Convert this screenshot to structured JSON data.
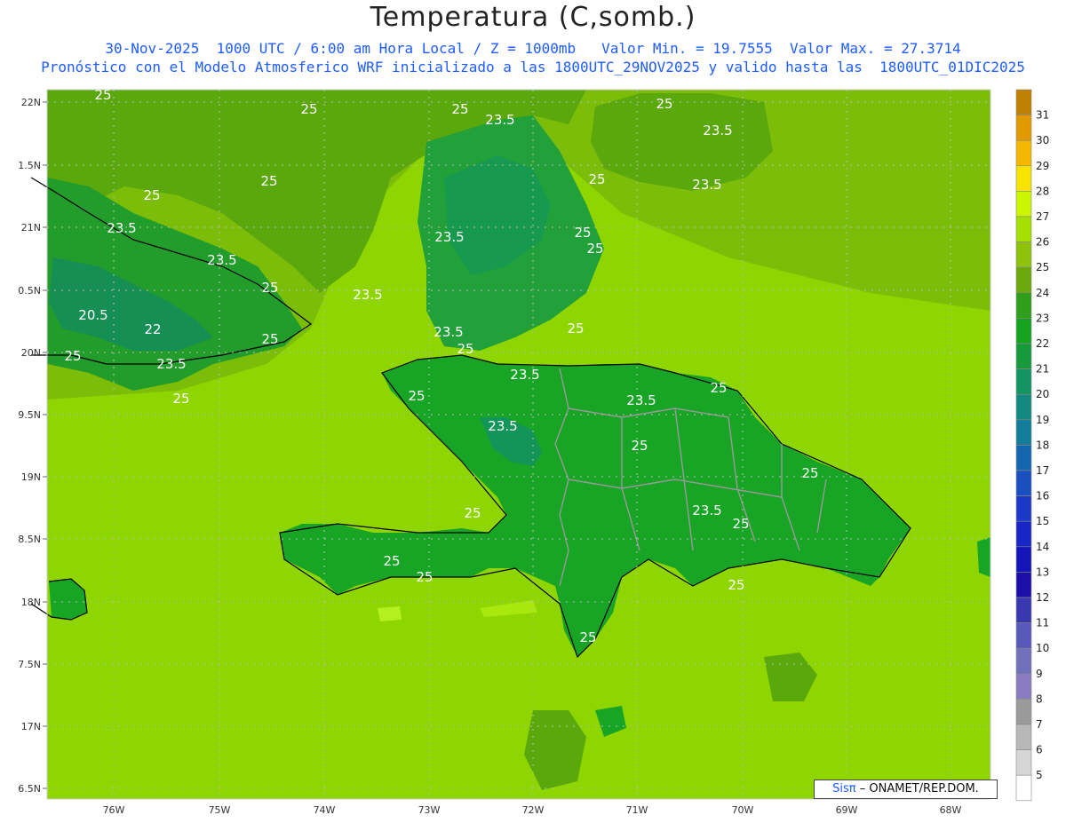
{
  "header": {
    "title": "Temperatura (C,somb.)",
    "line1": "30-Nov-2025  1000 UTC / 6:00 am Hora Local / Z = 1000mb   Valor Min. = 19.7555  Valor Max. = 27.3714",
    "line2": "Pronóstico con el Modelo Atmosferico WRF inicializado a las 1800UTC_29NOV2025 y valido hasta las  1800UTC_01DIC2025"
  },
  "map": {
    "lat_labels": [
      "22N",
      "1.5N",
      "21N",
      "0.5N",
      "20N",
      "9.5N",
      "19N",
      "8.5N",
      "18N",
      "7.5N",
      "17N",
      "6.5N"
    ],
    "lon_labels": [
      "76W",
      "75W",
      "74W",
      "73W",
      "72W",
      "71W",
      "70W",
      "69W",
      "68W"
    ],
    "contour_labels": [
      {
        "text": "25"
      },
      {
        "text": "25"
      },
      {
        "text": "25"
      },
      {
        "text": "23.5"
      },
      {
        "text": "25"
      },
      {
        "text": "23.5"
      },
      {
        "text": "25"
      },
      {
        "text": "25"
      },
      {
        "text": "23.5"
      },
      {
        "text": "25"
      },
      {
        "text": "23.5"
      },
      {
        "text": "25"
      },
      {
        "text": "25"
      },
      {
        "text": "20.5"
      },
      {
        "text": "22"
      },
      {
        "text": "23.5"
      },
      {
        "text": "23.5"
      },
      {
        "text": "25"
      },
      {
        "text": "23.5"
      },
      {
        "text": "25"
      },
      {
        "text": "25"
      },
      {
        "text": "25"
      },
      {
        "text": "23.5"
      },
      {
        "text": "25"
      },
      {
        "text": "23.5"
      },
      {
        "text": "23.5"
      },
      {
        "text": "23.5"
      },
      {
        "text": "25"
      },
      {
        "text": "23.5"
      },
      {
        "text": "23.5"
      },
      {
        "text": "25"
      },
      {
        "text": "25"
      },
      {
        "text": "25"
      },
      {
        "text": "25"
      },
      {
        "text": "25"
      },
      {
        "text": "25"
      }
    ]
  },
  "colorbar": {
    "levels": [
      {
        "label": "31",
        "color": "#c08000"
      },
      {
        "label": "30",
        "color": "#e09a00"
      },
      {
        "label": "29",
        "color": "#f5b800"
      },
      {
        "label": "28",
        "color": "#f5e400"
      },
      {
        "label": "27",
        "color": "#ccf500"
      },
      {
        "label": "26",
        "color": "#a6e000"
      },
      {
        "label": "25",
        "color": "#8fc20a"
      },
      {
        "label": "24",
        "color": "#6aa80e"
      },
      {
        "label": "23",
        "color": "#2f9e1a"
      },
      {
        "label": "22",
        "color": "#16a41e"
      },
      {
        "label": "21",
        "color": "#169a3c"
      },
      {
        "label": "20",
        "color": "#139460"
      },
      {
        "label": "19",
        "color": "#128a80"
      },
      {
        "label": "18",
        "color": "#137d9a"
      },
      {
        "label": "17",
        "color": "#1566b0"
      },
      {
        "label": "16",
        "color": "#1a4fc0"
      },
      {
        "label": "15",
        "color": "#1c38c8"
      },
      {
        "label": "14",
        "color": "#1826c8"
      },
      {
        "label": "13",
        "color": "#1414b8"
      },
      {
        "label": "12",
        "color": "#1a10a8"
      },
      {
        "label": "11",
        "color": "#3a38b0"
      },
      {
        "label": "10",
        "color": "#5858b8"
      },
      {
        "label": "9",
        "color": "#7070bc"
      },
      {
        "label": "8",
        "color": "#8a7cc0"
      },
      {
        "label": "7",
        "color": "#9a9a9a"
      },
      {
        "label": "6",
        "color": "#b8b8b8"
      },
      {
        "label": "5",
        "color": "#d6d6d6"
      },
      {
        "label": "",
        "color": "#ffffff"
      }
    ]
  },
  "credit": {
    "logo": "Sisπ",
    "text": "– ONAMET/REP.DOM."
  }
}
